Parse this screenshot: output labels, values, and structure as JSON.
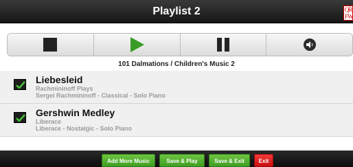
{
  "header": {
    "title": "Playlist 2",
    "logo_text": "QR FW"
  },
  "controls": {
    "icons": [
      "stop-icon",
      "play-icon",
      "pause-icon",
      "volume-icon"
    ],
    "play_color": "#3a9b26"
  },
  "now_playing": "101 Dalmations / Children's Music 2",
  "playlist": [
    {
      "title": "Liebesleid",
      "line1": "Rachmininoff Plays",
      "line2": "Sergei Rachmininoff - Classical - Solo Piano",
      "checked": true
    },
    {
      "title": "Gershwin Medley",
      "line1": "Liberace",
      "line2": "Liberace - Nostalgic - Solo Piano",
      "checked": true
    }
  ],
  "footer": {
    "add_more": "Add More Music",
    "save_play": "Save & Play",
    "save_exit": "Save & Exit",
    "exit": "Exit",
    "green_color": "#4caf2a",
    "red_color": "#e01b1b"
  }
}
